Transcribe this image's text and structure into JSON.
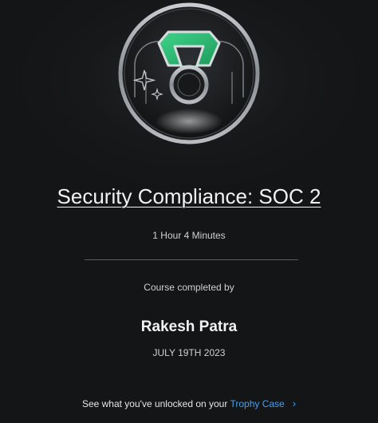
{
  "course": {
    "title": "Security Compliance: SOC 2",
    "duration": "1 Hour 4 Minutes"
  },
  "completion": {
    "label": "Course completed by",
    "learner_name": "Rakesh Patra",
    "date": "JULY 19TH 2023"
  },
  "footer": {
    "prefix": "See what you've unlocked on your ",
    "link_label": "Trophy Case",
    "chevron": "›"
  },
  "colors": {
    "background": "#141517",
    "accent_link": "#4a9fe8",
    "badge_gem": "#34c37a",
    "badge_ring": "#9aa0a6"
  },
  "icons": {
    "badge": "trophy-badge-icon",
    "chevron": "chevron-right-icon"
  }
}
